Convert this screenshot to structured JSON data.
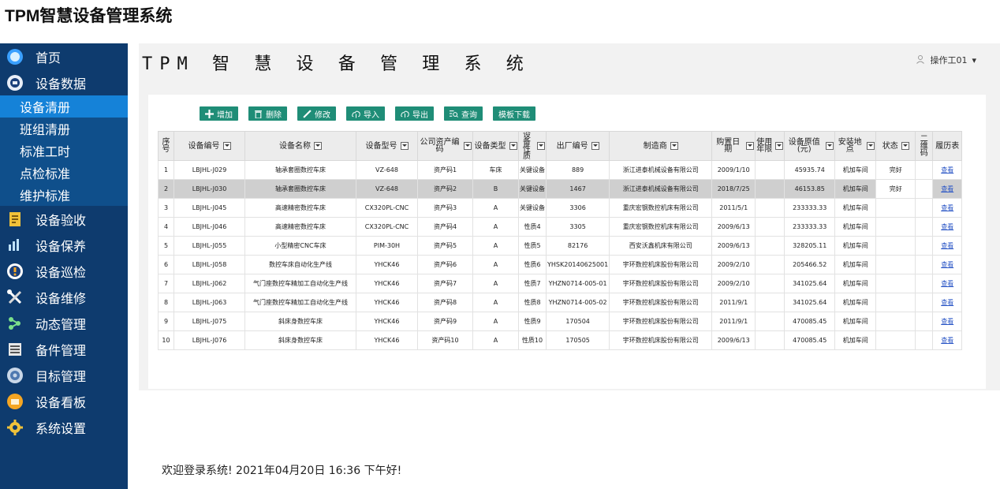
{
  "page_title": "TPM智慧设备管理系统",
  "app_title": "TPM 智 慧 设 备 管 理 系 统",
  "user": {
    "name": "操作工01",
    "caret": "▾"
  },
  "sidebar": {
    "items_top": [
      {
        "label": "首页",
        "icon": "home-icon"
      },
      {
        "label": "设备数据",
        "icon": "database-icon"
      }
    ],
    "sub_items": [
      {
        "label": "设备清册",
        "active": true
      },
      {
        "label": "班组清册"
      },
      {
        "label": "标准工时"
      },
      {
        "label": "点检标准"
      },
      {
        "label": "维护标准"
      }
    ],
    "items_bottom": [
      {
        "label": "设备验收",
        "icon": "acceptance-icon"
      },
      {
        "label": "设备保养",
        "icon": "maintenance-icon"
      },
      {
        "label": "设备巡检",
        "icon": "inspection-icon"
      },
      {
        "label": "设备维修",
        "icon": "repair-icon"
      },
      {
        "label": "动态管理",
        "icon": "dynamic-icon"
      },
      {
        "label": "备件管理",
        "icon": "spare-parts-icon"
      },
      {
        "label": "目标管理",
        "icon": "target-icon"
      },
      {
        "label": "设备看板",
        "icon": "board-icon"
      },
      {
        "label": "系统设置",
        "icon": "settings-icon"
      }
    ]
  },
  "toolbar": {
    "add": "增加",
    "delete": "删除",
    "edit": "修改",
    "import": "导入",
    "export": "导出",
    "query": "查询",
    "template": "模板下载"
  },
  "table": {
    "headers": [
      {
        "label": "序号",
        "filter": false
      },
      {
        "label": "设备编号",
        "filter": true
      },
      {
        "label": "设备名称",
        "filter": true
      },
      {
        "label": "设备型号",
        "filter": true
      },
      {
        "label": "公司资产编码",
        "filter": true
      },
      {
        "label": "设备类型",
        "filter": true
      },
      {
        "label": "设备性质",
        "filter": true
      },
      {
        "label": "出厂编号",
        "filter": true
      },
      {
        "label": "制造商",
        "filter": true
      },
      {
        "label": "购置日期",
        "filter": true
      },
      {
        "label": "使用年限",
        "filter": true
      },
      {
        "label": "设备原值(元)",
        "filter": true
      },
      {
        "label": "安装地点",
        "filter": true
      },
      {
        "label": "状态",
        "filter": true
      },
      {
        "label": "二维码",
        "filter": false
      },
      {
        "label": "履历表",
        "filter": false
      }
    ],
    "rows": [
      [
        "1",
        "LBJHL-J029",
        "轴承套圈数控车床",
        "VZ-648",
        "资产码1",
        "车床",
        "关键设备",
        "889",
        "浙江进泰机械设备有限公司",
        "2009/1/10",
        "",
        "45935.74",
        "机加车间",
        "完好",
        "",
        "查看"
      ],
      [
        "2",
        "LBJHL-J030",
        "轴承套圈数控车床",
        "VZ-648",
        "资产码2",
        "B",
        "关键设备",
        "1467",
        "浙江进泰机械设备有限公司",
        "2018/7/25",
        "",
        "46153.85",
        "机加车间",
        "完好",
        "",
        "查看"
      ],
      [
        "3",
        "LBJHL-J045",
        "高速精密数控车床",
        "CX320PL-CNC",
        "资产码3",
        "A",
        "关键设备",
        "3306",
        "重庆宏钢数控机床有限公司",
        "2011/5/1",
        "",
        "233333.33",
        "机加车间",
        "",
        "",
        "查看"
      ],
      [
        "4",
        "LBJHL-J046",
        "高速精密数控车床",
        "CX320PL-CNC",
        "资产码4",
        "A",
        "性质4",
        "3305",
        "重庆宏钢数控机床有限公司",
        "2009/6/13",
        "",
        "233333.33",
        "机加车间",
        "",
        "",
        "查看"
      ],
      [
        "5",
        "LBJHL-J055",
        "小型精密CNC车床",
        "PIM-30H",
        "资产码5",
        "A",
        "性质5",
        "82176",
        "西安沃鑫机床有限公司",
        "2009/6/13",
        "",
        "328205.11",
        "机加车间",
        "",
        "",
        "查看"
      ],
      [
        "6",
        "LBJHL-J058",
        "数控车床自动化生产线",
        "YHCK46",
        "资产码6",
        "A",
        "性质6",
        "YHSK20140625001",
        "宇环数控机床股份有限公司",
        "2009/2/10",
        "",
        "205466.52",
        "机加车间",
        "",
        "",
        "查看"
      ],
      [
        "7",
        "LBJHL-J062",
        "气门座数控车精加工自动化生产线",
        "YHCK46",
        "资产码7",
        "A",
        "性质7",
        "YHZN0714-005-01",
        "宇环数控机床股份有限公司",
        "2009/2/10",
        "",
        "341025.64",
        "机加车间",
        "",
        "",
        "查看"
      ],
      [
        "8",
        "LBJHL-J063",
        "气门座数控车精加工自动化生产线",
        "YHCK46",
        "资产码8",
        "A",
        "性质8",
        "YHZN0714-005-02",
        "宇环数控机床股份有限公司",
        "2011/9/1",
        "",
        "341025.64",
        "机加车间",
        "",
        "",
        "查看"
      ],
      [
        "9",
        "LBJHL-J075",
        "斜床身数控车床",
        "YHCK46",
        "资产码9",
        "A",
        "性质9",
        "170504",
        "宇环数控机床股份有限公司",
        "2011/9/1",
        "",
        "470085.45",
        "机加车间",
        "",
        "",
        "查看"
      ],
      [
        "10",
        "LBJHL-J076",
        "斜床身数控车床",
        "YHCK46",
        "资产码10",
        "A",
        "性质10",
        "170505",
        "宇环数控机床股份有限公司",
        "2009/6/13",
        "",
        "470085.45",
        "机加车间",
        "",
        "",
        "查看"
      ]
    ],
    "selected_row": 1
  },
  "welcome": "欢迎登录系统!  2021年04月20日 16:36 下午好!",
  "colors": {
    "sidebar": "#0e3b6e",
    "sub_menu": "#0f4f8b",
    "active": "#1582d8",
    "button": "#1f8d77"
  }
}
